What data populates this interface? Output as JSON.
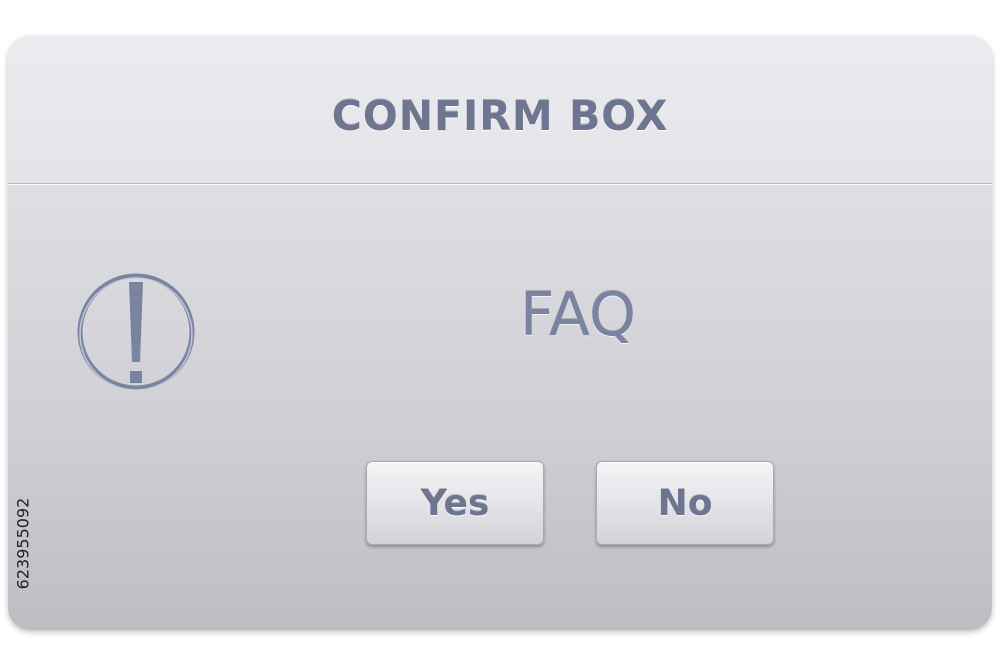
{
  "dialog": {
    "title": "CONFIRM BOX",
    "message": "FAQ",
    "icon": "exclamation-circle-icon",
    "buttons": {
      "yes_label": "Yes",
      "no_label": "No"
    }
  },
  "watermark": {
    "stock_id": "623955092"
  },
  "colors": {
    "text": "#6d7591",
    "dialog_top": "#e9e9ed",
    "dialog_bottom": "#bdbdc3"
  }
}
